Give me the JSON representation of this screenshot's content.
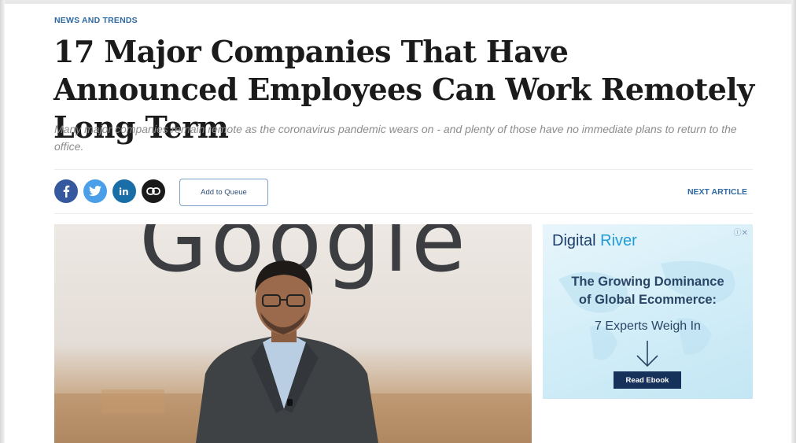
{
  "article": {
    "category": "NEWS AND TRENDS",
    "headline": "17 Major Companies That Have Announced Employees Can Work Remotely Long Term",
    "dek": "Many major companies remain remote as the coronavirus pandemic wears on - and plenty of those have no immediate plans to return to the office."
  },
  "share": {
    "icons": [
      "facebook-icon",
      "twitter-icon",
      "linkedin-icon",
      "link-icon"
    ],
    "queue_label": "Add to Queue",
    "next_label": "NEXT ARTICLE"
  },
  "hero": {
    "logo_text": "Google"
  },
  "ad": {
    "brand_part1": "Digital",
    "brand_part2": "River",
    "title_line1": "The Growing Dominance",
    "title_line2": "of Global Ecommerce:",
    "subtitle": "7 Experts Weigh In",
    "cta": "Read Ebook",
    "ad_choices": "ⓘ✕"
  },
  "colors": {
    "category_blue": "#2f6aa3",
    "facebook": "#36589e",
    "twitter": "#4a9fe8",
    "linkedin": "#1a6ea8",
    "ad_button": "#17325a"
  }
}
